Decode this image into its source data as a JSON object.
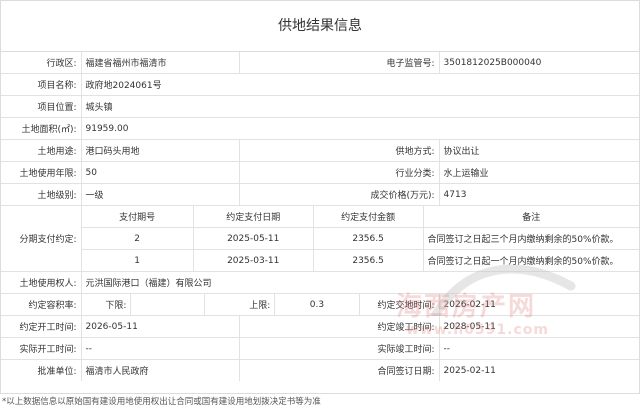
{
  "title": "供地结果信息",
  "fields": {
    "district": {
      "label": "行政区:",
      "value": "福建省福州市福清市"
    },
    "supervision_no": {
      "label": "电子监管号:",
      "value": "3501812025B000040"
    },
    "project_name": {
      "label": "项目名称:",
      "value": "政府地2024061号"
    },
    "project_location": {
      "label": "项目位置:",
      "value": "城头镇"
    },
    "land_area": {
      "label": "土地面积(㎡):",
      "value": "91959.00"
    },
    "land_use": {
      "label": "土地用途:",
      "value": "港口码头用地"
    },
    "supply_method": {
      "label": "供地方式:",
      "value": "协议出让"
    },
    "use_years": {
      "label": "土地使用年限:",
      "value": "50"
    },
    "industry": {
      "label": "行业分类:",
      "value": "水上运输业"
    },
    "land_grade": {
      "label": "土地级别:",
      "value": "一级"
    },
    "price": {
      "label": "成交价格(万元):",
      "value": "4713"
    },
    "installments_label": "分期支付约定:",
    "owner": {
      "label": "土地使用权人:",
      "value": "元洪国际港口（福建）有限公司"
    },
    "far_label": "约定容积率:",
    "far_lower_label": "下限:",
    "far_lower_value": "",
    "far_upper_label": "上限:",
    "far_upper_value": "0.3",
    "delivery_time": {
      "label": "约定交地时间:",
      "value": "2026-02-11"
    },
    "start_time": {
      "label": "约定开工时间:",
      "value": "2026-05-11"
    },
    "completion_time": {
      "label": "约定竣工时间:",
      "value": "2028-05-11"
    },
    "actual_start": {
      "label": "实际开工时间:",
      "value": "--"
    },
    "actual_completion": {
      "label": "实际竣工时间:",
      "value": "--"
    },
    "approval_unit": {
      "label": "批准单位:",
      "value": "福清市人民政府"
    },
    "contract_date": {
      "label": "合同签订日期:",
      "value": "2025-02-11"
    }
  },
  "installments": {
    "headers": [
      "支付期号",
      "约定支付日期",
      "约定支付金额",
      "备注"
    ],
    "rows": [
      {
        "no": "2",
        "date": "2025-05-11",
        "amount": "2356.5",
        "note": "合同签订之日起三个月内缴纳剩余的50%价款。"
      },
      {
        "no": "1",
        "date": "2025-03-11",
        "amount": "2356.5",
        "note": "合同签订之日起一个月内缴纳剩余的50%价款。"
      }
    ]
  },
  "footnote": "*以上数据信息以原始国有建设用地使用权出让合同或国有建设用地划拨决定书等为准",
  "watermark": {
    "text": "海西房产网",
    "url": "www.h0591.com"
  }
}
